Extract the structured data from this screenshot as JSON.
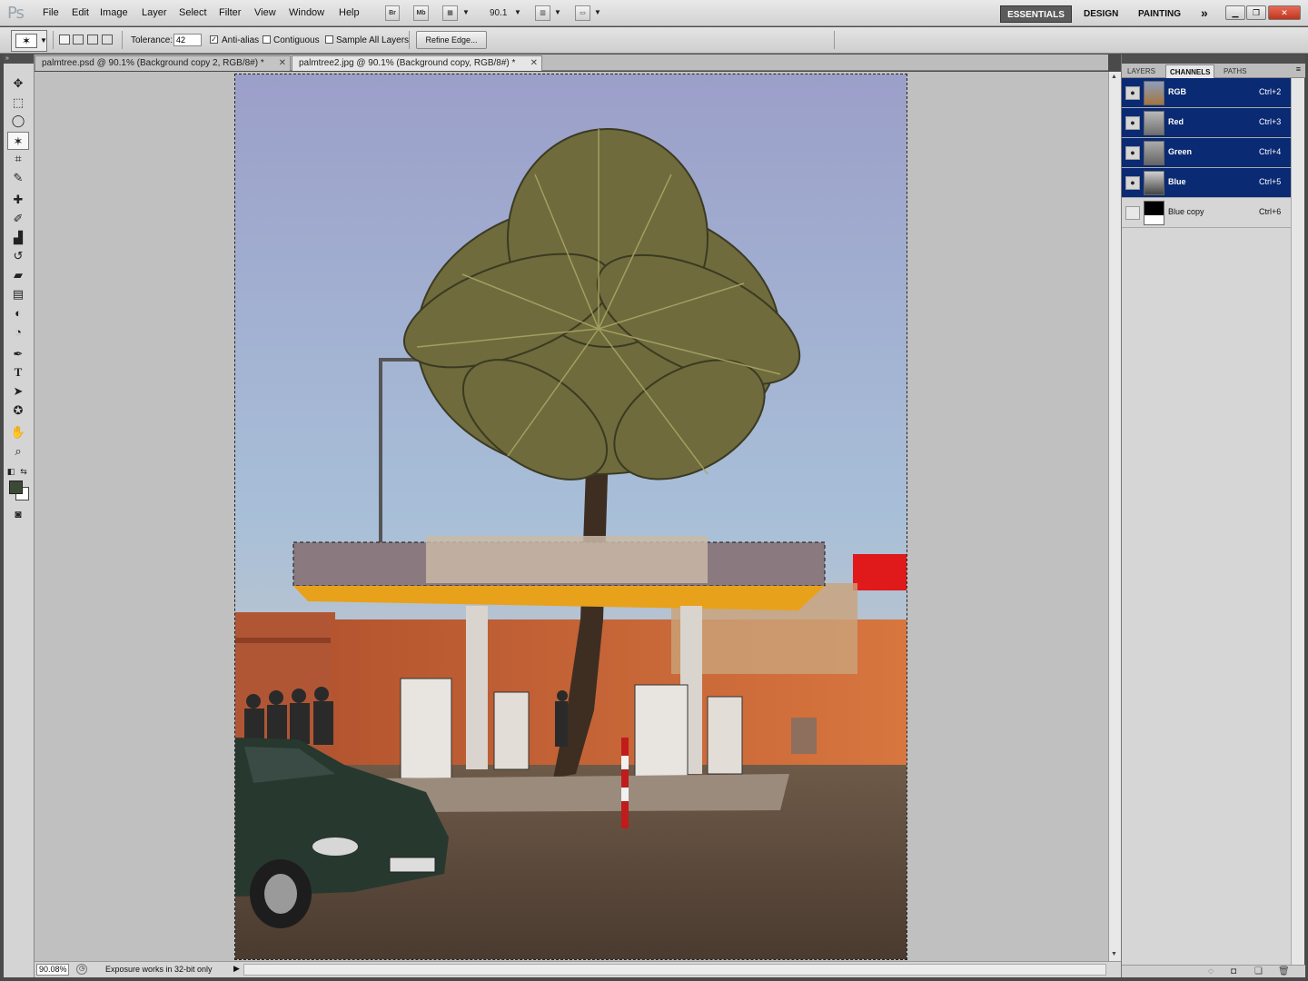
{
  "menubar": {
    "logo": "Ps",
    "items": [
      "File",
      "Edit",
      "Image",
      "Layer",
      "Select",
      "Filter",
      "View",
      "Window",
      "Help"
    ],
    "bridge_label": "Br",
    "minibridge_label": "Mb",
    "zoom": "90.1",
    "workspaces": [
      "ESSENTIALS",
      "DESIGN",
      "PAINTING"
    ],
    "more": "»"
  },
  "options": {
    "tolerance_label": "Tolerance:",
    "tolerance_value": "42",
    "antialias_label": "Anti-alias",
    "antialias_checked": true,
    "contiguous_label": "Contiguous",
    "contiguous_checked": false,
    "sample_all_label": "Sample All Layers",
    "sample_all_checked": false,
    "refine_edge_label": "Refine Edge..."
  },
  "doc_tabs": [
    {
      "title": "palmtree.psd @ 90.1% (Background copy 2, RGB/8#) *",
      "active": false
    },
    {
      "title": "palmtree2.jpg @ 90.1% (Background copy, RGB/8#) *",
      "active": true
    }
  ],
  "colors": {
    "foreground": "#3c4a35",
    "background": "#ffffff",
    "selection_blue": "#0a2a73"
  },
  "status": {
    "zoom": "90.08%",
    "message": "Exposure works in 32-bit only"
  },
  "panel": {
    "tabs": [
      "LAYERS",
      "CHANNELS",
      "PATHS"
    ],
    "active_tab": "CHANNELS",
    "channels": [
      {
        "name": "RGB",
        "shortcut": "Ctrl+2",
        "selected": true,
        "visible": true
      },
      {
        "name": "Red",
        "shortcut": "Ctrl+3",
        "selected": true,
        "visible": true
      },
      {
        "name": "Green",
        "shortcut": "Ctrl+4",
        "selected": true,
        "visible": true
      },
      {
        "name": "Blue",
        "shortcut": "Ctrl+5",
        "selected": true,
        "visible": true
      },
      {
        "name": "Blue copy",
        "shortcut": "Ctrl+6",
        "selected": false,
        "visible": false
      }
    ]
  }
}
